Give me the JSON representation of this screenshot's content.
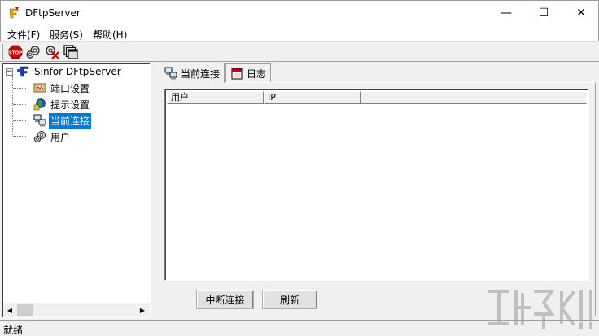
{
  "window": {
    "title": "DFtpServer",
    "minimize_glyph": "—",
    "maximize_glyph": "☐",
    "close_glyph": "✕"
  },
  "menu": [
    {
      "label": "文件(F)"
    },
    {
      "label": "服务(S)"
    },
    {
      "label": "帮助(H)"
    }
  ],
  "toolbar": {
    "buttons": [
      {
        "icon": "stop-icon",
        "label": "STOP"
      },
      {
        "icon": "connect-icon"
      },
      {
        "icon": "disconnect-icon"
      },
      {
        "icon": "windows-icon"
      }
    ]
  },
  "tree": {
    "root": {
      "label": "Sinfor DFtpServer",
      "expander": "−"
    },
    "items": [
      {
        "label": "端口设置",
        "icon": "port-settings-icon"
      },
      {
        "label": "提示设置",
        "icon": "prompt-settings-icon"
      },
      {
        "label": "当前连接",
        "icon": "connections-icon",
        "selected": true
      },
      {
        "label": "用户",
        "icon": "users-icon"
      }
    ]
  },
  "tabs": [
    {
      "label": "当前连接",
      "icon": "connections-icon",
      "active": true
    },
    {
      "label": "日志",
      "icon": "log-icon",
      "active": false
    }
  ],
  "list": {
    "columns": [
      "用户",
      "IP"
    ],
    "rows": []
  },
  "buttons": {
    "disconnect": "中断连接",
    "refresh": "刷新"
  },
  "status": {
    "text": "就绪"
  },
  "colors": {
    "selection": "#0078d7",
    "face": "#f0f0f0"
  }
}
